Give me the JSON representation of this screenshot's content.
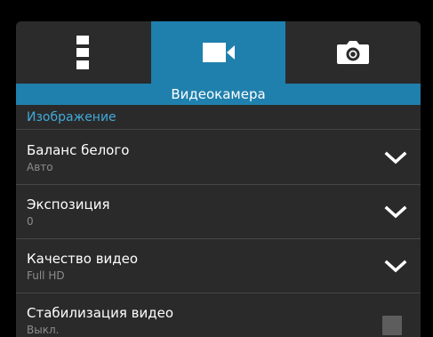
{
  "tabs": [
    {
      "name": "menu",
      "icon": "vertical-dots-icon",
      "active": false
    },
    {
      "name": "video",
      "icon": "video-camera-icon",
      "active": true
    },
    {
      "name": "photo",
      "icon": "camera-icon",
      "active": false
    }
  ],
  "title": "Видеокамера",
  "section": "Изображение",
  "settings": [
    {
      "label": "Баланс белого",
      "value": "Авто",
      "control": "chevron-down-icon"
    },
    {
      "label": "Экспозиция",
      "value": "0",
      "control": "chevron-down-icon"
    },
    {
      "label": "Качество видео",
      "value": "Full HD",
      "control": "chevron-down-icon"
    },
    {
      "label": "Стабилизация видео",
      "value": "Выкл.",
      "control": "checkbox",
      "checked": false
    }
  ],
  "colors": {
    "accent": "#1f80ad",
    "section_text": "#41a9d9",
    "background": "#2a2a2a"
  }
}
